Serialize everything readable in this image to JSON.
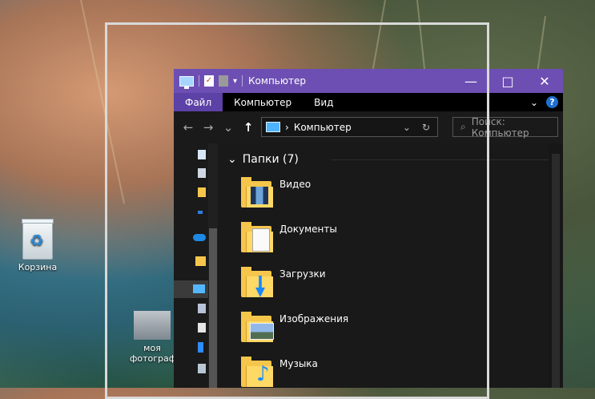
{
  "desktop": {
    "recycle_bin_label": "Корзина",
    "photo_label": "моя фотограф"
  },
  "window": {
    "title": "Компьютер",
    "controls": {
      "minimize": "—",
      "maximize": "□",
      "close": "✕"
    }
  },
  "ribbon": {
    "tabs": [
      {
        "label": "Файл"
      },
      {
        "label": "Компьютер"
      },
      {
        "label": "Вид"
      }
    ],
    "expand_icon": "chevron-down-icon",
    "help": "?"
  },
  "address": {
    "back": "←",
    "forward": "→",
    "recent": "⌄",
    "up": "↑",
    "path": "Компьютер",
    "dropdown": "⌄",
    "refresh": "↻",
    "search_placeholder": "Поиск: Компьютер"
  },
  "folders_group": {
    "title": "Папки (7)",
    "items": [
      {
        "label": "Видео",
        "icon": "video-folder-icon"
      },
      {
        "label": "Документы",
        "icon": "documents-folder-icon"
      },
      {
        "label": "Загрузки",
        "icon": "downloads-folder-icon"
      },
      {
        "label": "Изображения",
        "icon": "pictures-folder-icon"
      },
      {
        "label": "Музыка",
        "icon": "music-folder-icon"
      }
    ]
  }
}
